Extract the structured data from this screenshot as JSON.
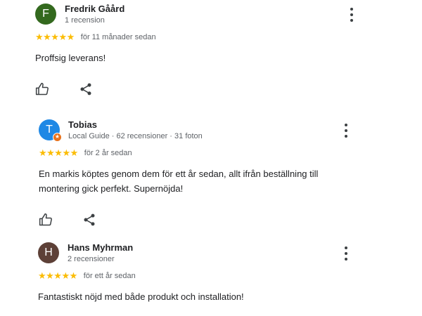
{
  "reviews": [
    {
      "initial": "F",
      "avatar_color": "#33691e",
      "name": "Fredrik Gåård",
      "meta": "1 recension",
      "stars": "★★★★★",
      "rating": 5,
      "date": "för 11 månader sedan",
      "text": "Proffsig leverans!",
      "local_guide": false
    },
    {
      "initial": "T",
      "avatar_color": "#1e88e5",
      "name": "Tobias",
      "meta": "Local Guide · 62 recensioner · 31 foton",
      "stars": "★★★★★",
      "rating": 5,
      "date": "för 2 år sedan",
      "text": "En markis köptes genom dem för ett år sedan, allt ifrån beställning till montering gick perfekt. Supernöjda!",
      "local_guide": true,
      "badge_glyph": "★"
    },
    {
      "initial": "H",
      "avatar_color": "#5d4037",
      "name": "Hans Myhrman",
      "meta": "2 recensioner",
      "stars": "★★★★★",
      "rating": 5,
      "date": "för ett år sedan",
      "text": "Fantastiskt nöjd med både produkt och installation!",
      "local_guide": false
    }
  ],
  "icons": {
    "like": "thumbs-up-icon",
    "share": "share-icon",
    "menu": "more-vertical-icon"
  },
  "colors": {
    "star": "#fbbc04",
    "text": "#202124",
    "secondary": "#5f6368"
  }
}
